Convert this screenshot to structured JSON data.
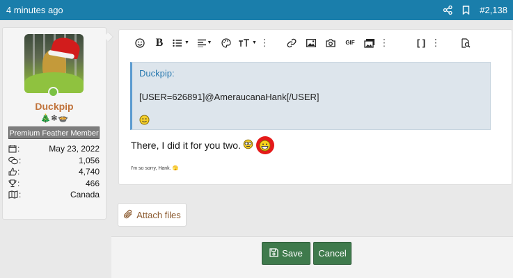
{
  "post": {
    "time": "4 minutes ago",
    "number": "#2,138",
    "icons": [
      "share-icon",
      "bookmark-icon"
    ]
  },
  "user": {
    "name": "Duckpip",
    "badges": "🎄❄🍲",
    "title": "Premium Feather Member",
    "stats": [
      {
        "icon": "calendar-icon",
        "sep": ":",
        "value": "May 23, 2022"
      },
      {
        "icon": "messages-icon",
        "sep": ":",
        "value": "1,056"
      },
      {
        "icon": "reactions-icon",
        "sep": ":",
        "value": "4,740"
      },
      {
        "icon": "trophy-icon",
        "sep": ":",
        "value": "466"
      },
      {
        "icon": "location-icon",
        "sep": ":",
        "value": "Canada"
      }
    ]
  },
  "editor": {
    "toolbar": [
      "smilies-icon",
      "bold-icon",
      "list-icon",
      "align-icon",
      "color-icon",
      "font-size-icon",
      "more-icon",
      "link-icon",
      "image-icon",
      "camera-icon",
      "gif-icon",
      "media-icon",
      "more-icon",
      "bbcode-icon",
      "more-icon",
      "preview-icon"
    ],
    "bold_label": "B",
    "gif_label": "GIF",
    "bbcode_label": "[ ]",
    "quote": {
      "author": "Duckpip:",
      "text": "[USER=626891]@AmeraucanaHank[/USER]"
    },
    "message": "There, I did it for you two.",
    "small_text": "I'm so sorry, Hank. 🫣"
  },
  "actions": {
    "attach_label": "Attach files",
    "save_label": "Save",
    "cancel_label": "Cancel"
  },
  "colors": {
    "topbar": "#1a7eab",
    "username": "#c0723a",
    "button": "#3f7a4c",
    "highlight": "#e51a1a"
  }
}
